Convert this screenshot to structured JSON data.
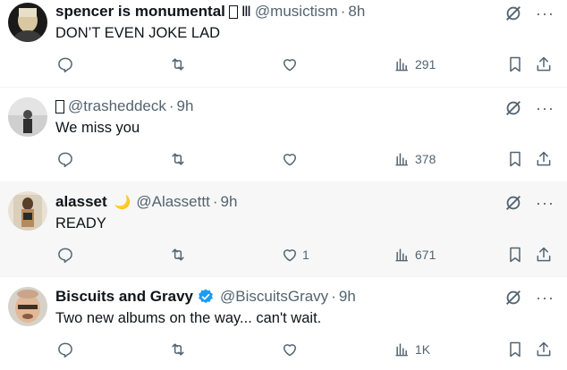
{
  "tweets": [
    {
      "name": "spencer is monumental",
      "name_extra": "Ⅲ",
      "handle": "@musictism",
      "time": "8h",
      "text": "DON’T EVEN JOKE LAD",
      "likes": "",
      "views": "291"
    },
    {
      "name": "",
      "handle": "@trasheddeck",
      "time": "9h",
      "text": "We miss you",
      "likes": "",
      "views": "378"
    },
    {
      "name": "alasset",
      "name_extra": "🌙",
      "handle": "@Alassettt",
      "time": "9h",
      "text": "READY",
      "likes": "1",
      "views": "671"
    },
    {
      "name": "Biscuits and Gravy",
      "handle": "@BiscuitsGravy",
      "time": "9h",
      "text": "Two new albums on the way... can't wait.",
      "likes": "",
      "views": "1K"
    }
  ],
  "separator": "·",
  "more_label": "···",
  "colors": {
    "text": "#0f1419",
    "muted": "#536471",
    "verified": "#1d9bf0",
    "highlight_row": "#f7f7f7"
  },
  "icons": [
    "grok-icon",
    "more-icon",
    "reply-icon",
    "retweet-icon",
    "like-icon",
    "views-icon",
    "bookmark-icon",
    "share-icon",
    "verified-badge-icon"
  ]
}
